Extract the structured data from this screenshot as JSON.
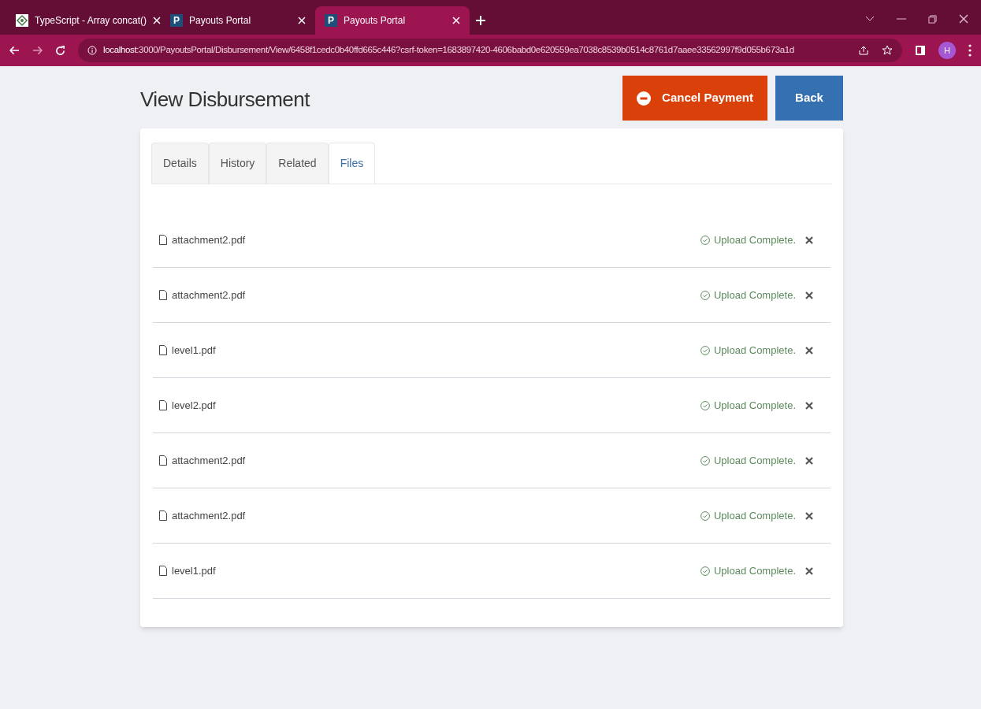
{
  "browser": {
    "tabs": [
      {
        "title": "TypeScript - Array concat()",
        "kind": "site",
        "selected": false
      },
      {
        "title": "Payouts Portal",
        "kind": "portal",
        "favicon_letter": "P",
        "selected": false
      },
      {
        "title": "Payouts Portal",
        "kind": "portal",
        "favicon_letter": "P",
        "selected": true
      }
    ],
    "url_host": "localhost",
    "url_rest": ":3000/PayoutsPortal/Disbursement/View/6458f1cedc0b40ffd665c446?csrf-token=1683897420-4606babd0e620559ea7038c8539b0514c8761d7aaee33562997f9d055b673a1d",
    "profile_initial": "H"
  },
  "page": {
    "title": "View Disbursement",
    "buttons": [
      {
        "label": "Cancel Payment",
        "kind": "danger"
      },
      {
        "label": "Back",
        "kind": "primary"
      }
    ],
    "tabs": [
      {
        "label": "Details",
        "selected": false
      },
      {
        "label": "History",
        "selected": false
      },
      {
        "label": "Related",
        "selected": false
      },
      {
        "label": "Files",
        "selected": true
      }
    ],
    "files": [
      {
        "name": "attachment2.pdf",
        "status": "Upload Complete."
      },
      {
        "name": "attachment2.pdf",
        "status": "Upload Complete."
      },
      {
        "name": "level1.pdf",
        "status": "Upload Complete."
      },
      {
        "name": "level2.pdf",
        "status": "Upload Complete."
      },
      {
        "name": "attachment2.pdf",
        "status": "Upload Complete."
      },
      {
        "name": "attachment2.pdf",
        "status": "Upload Complete."
      },
      {
        "name": "level1.pdf",
        "status": "Upload Complete."
      }
    ]
  }
}
